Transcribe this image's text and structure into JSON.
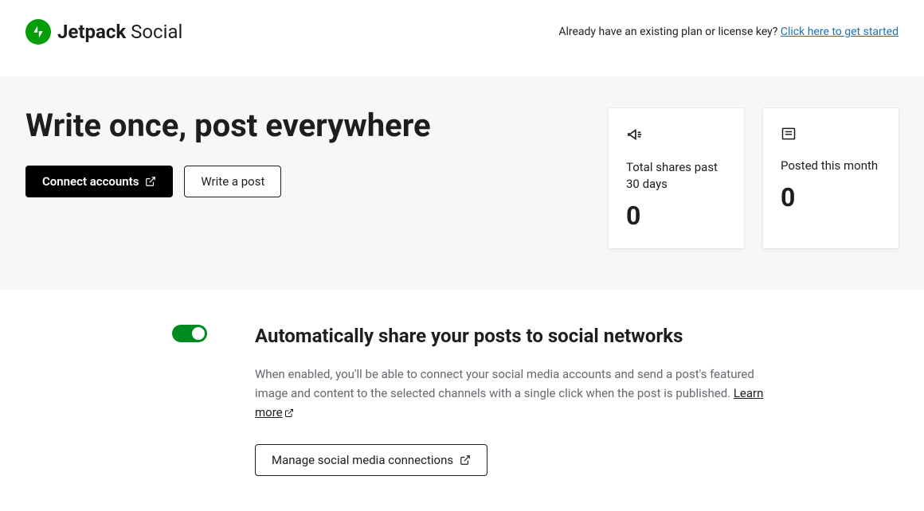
{
  "header": {
    "brand_bold": "Jetpack",
    "brand_light": "Social",
    "license_prompt": "Already have an existing plan or license key? ",
    "license_link": "Click here to get started"
  },
  "hero": {
    "title": "Write once, post everywhere",
    "connect_label": "Connect accounts",
    "write_label": "Write a post",
    "cards": [
      {
        "label": "Total shares past 30 days",
        "value": "0",
        "icon": "megaphone-icon"
      },
      {
        "label": "Posted this month",
        "value": "0",
        "icon": "post-list-icon"
      }
    ]
  },
  "auto_share": {
    "toggle_on": true,
    "title": "Automatically share your posts to social networks",
    "description": "When enabled, you'll be able to connect your social media accounts and send a post's featured image and content to the selected channels with a single click when the post is published. ",
    "learn_more": "Learn more",
    "manage_label": "Manage social media connections"
  }
}
